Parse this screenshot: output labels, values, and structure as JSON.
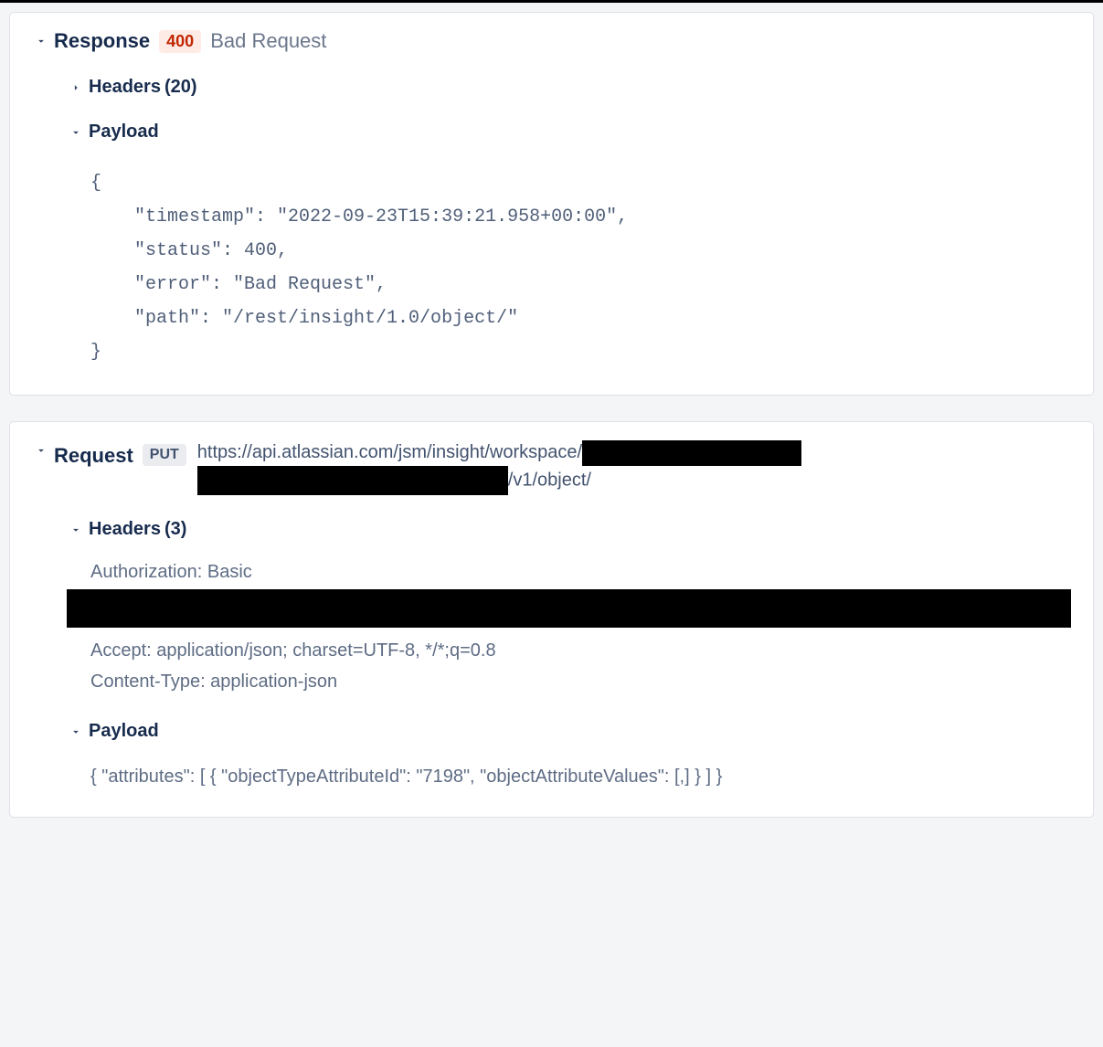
{
  "response": {
    "label": "Response",
    "status_code": "400",
    "status_text": "Bad Request",
    "headers_label": "Headers",
    "headers_count": "(20)",
    "payload_label": "Payload",
    "payload_body": "{\n    \"timestamp\": \"2022-09-23T15:39:21.958+00:00\",\n    \"status\": 400,\n    \"error\": \"Bad Request\",\n    \"path\": \"/rest/insight/1.0/object/\"\n}"
  },
  "request": {
    "label": "Request",
    "method": "PUT",
    "url_part1": "https://api.atlassian.com/jsm/insight/workspace/",
    "url_part2": "/v1/object/",
    "headers_label": "Headers",
    "headers_count": "(3)",
    "header_auth_prefix": "Authorization: Basic",
    "header_accept": "Accept: application/json; charset=UTF-8, */*;q=0.8",
    "header_content_type": "Content-Type: application-json",
    "payload_label": "Payload",
    "payload_body": "{ \"attributes\": [ { \"objectTypeAttributeId\": \"7198\", \"objectAttributeValues\": [,] } ] }"
  }
}
